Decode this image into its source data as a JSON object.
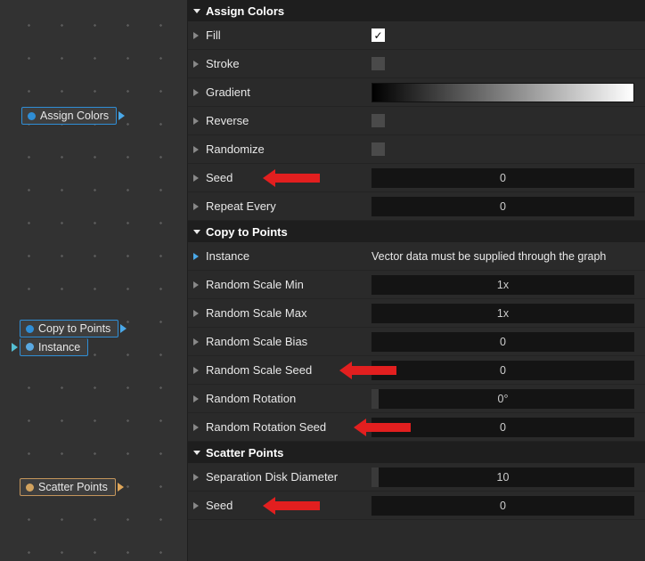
{
  "graph": {
    "nodes": {
      "assign": "Assign Colors",
      "copy": "Copy to Points",
      "instance": "Instance",
      "scatter": "Scatter Points"
    }
  },
  "sections": {
    "assign": {
      "title": "Assign Colors",
      "fill": "Fill",
      "stroke": "Stroke",
      "gradient": "Gradient",
      "reverse": "Reverse",
      "randomize": "Randomize",
      "seed": "Seed",
      "seed_val": "0",
      "repeat": "Repeat Every",
      "repeat_val": "0"
    },
    "copy": {
      "title": "Copy to Points",
      "instance": "Instance",
      "instance_hint": "Vector data must be supplied through the graph",
      "rsmin": "Random Scale Min",
      "rsmin_val": "1x",
      "rsmax": "Random Scale Max",
      "rsmax_val": "1x",
      "rsbias": "Random Scale Bias",
      "rsbias_val": "0",
      "rsseed": "Random Scale Seed",
      "rsseed_val": "0",
      "rrot": "Random Rotation",
      "rrot_val": "0°",
      "rrotseed": "Random Rotation Seed",
      "rrotseed_val": "0"
    },
    "scatter": {
      "title": "Scatter Points",
      "sep": "Separation Disk Diameter",
      "sep_val": "10",
      "seed": "Seed",
      "seed_val": "0"
    }
  }
}
